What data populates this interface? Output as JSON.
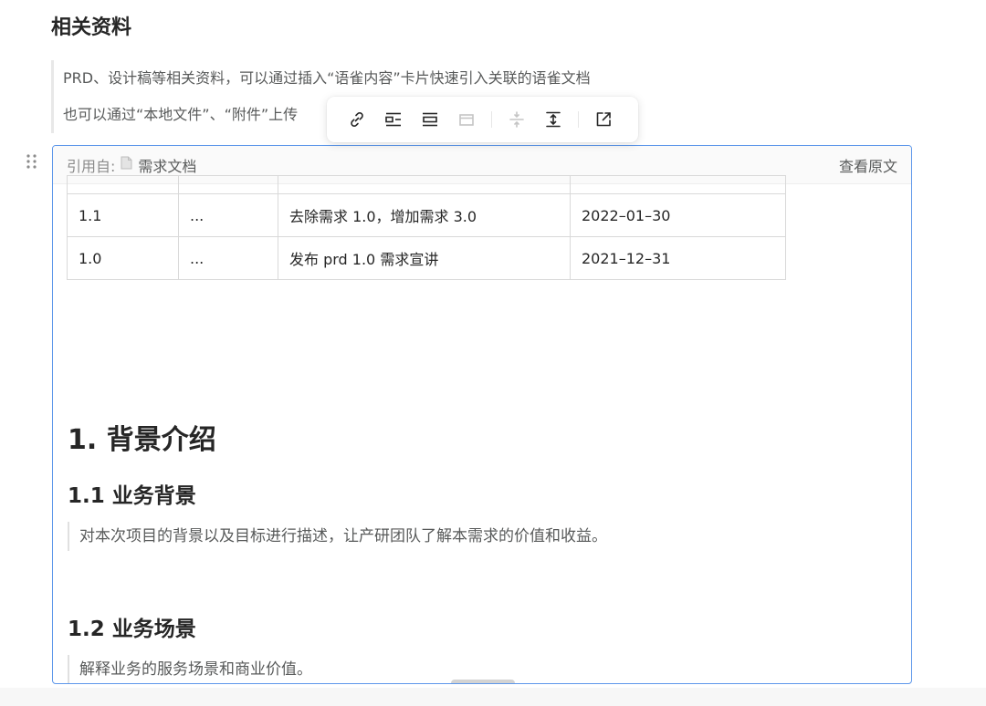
{
  "page": {
    "title": "相关资料"
  },
  "quote": {
    "line1": "PRD、设计稿等相关资料，可以通过插入“语雀内容”卡片快速引入关联的语雀文档",
    "line2": "也可以通过“本地文件”、“附件”上传"
  },
  "toolbar": {
    "buttons": [
      {
        "icon": "link-icon",
        "enabled": true
      },
      {
        "icon": "align-left-icon",
        "enabled": true
      },
      {
        "icon": "align-center-icon",
        "enabled": true
      },
      {
        "icon": "embed-icon",
        "enabled": false
      },
      {
        "icon": "collapse-icon",
        "enabled": false
      },
      {
        "icon": "expand-height-icon",
        "enabled": true
      },
      {
        "icon": "open-external-icon",
        "enabled": true
      }
    ]
  },
  "card": {
    "source_prefix": "引用自:",
    "source_doc": "需求文档",
    "view_original": "查看原文",
    "revision_table": {
      "rows": [
        [
          "1.1",
          "...",
          "去除需求 1.0，增加需求 3.0",
          "2022–01–30"
        ],
        [
          "1.0",
          "...",
          "发布 prd 1.0 需求宣讲",
          "2021–12–31"
        ]
      ]
    },
    "sections": {
      "h1": "1. 背景介绍",
      "s1_title": "1.1 业务背景",
      "s1_text": "对本次项目的背景以及目标进行描述，让产研团队了解本需求的价值和收益。",
      "s2_title": "1.2 业务场景",
      "s2_text": "解释业务的服务场景和商业价值。"
    }
  },
  "colors": {
    "card_border": "#5d97ea",
    "text_primary": "#262626",
    "text_secondary": "#585a5a",
    "disabled": "#c5c5c5"
  }
}
